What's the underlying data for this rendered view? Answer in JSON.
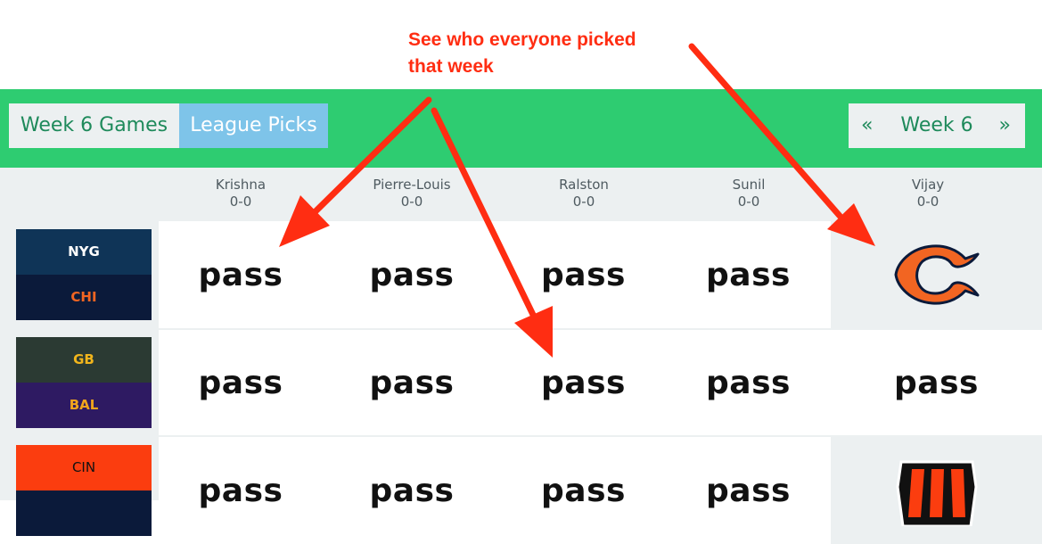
{
  "annotation": {
    "line1": "See who everyone picked",
    "line2": "that week"
  },
  "tabs": {
    "games": "Week 6 Games",
    "picks": "League Picks"
  },
  "week_nav": {
    "prev": "«",
    "label": "Week 6",
    "next": "»"
  },
  "players": [
    {
      "name": "Krishna",
      "record": "0-0"
    },
    {
      "name": "Pierre-Louis",
      "record": "0-0"
    },
    {
      "name": "Ralston",
      "record": "0-0"
    },
    {
      "name": "Sunil",
      "record": "0-0"
    },
    {
      "name": "Vijay",
      "record": "0-0"
    }
  ],
  "games": [
    {
      "away": {
        "abbr": "NYG",
        "bg": "#0f3457",
        "fg": "#ffffff"
      },
      "home": {
        "abbr": "CHI",
        "bg": "#0b1a3a",
        "fg": "#f26522"
      },
      "picks": [
        "pass",
        "pass",
        "pass",
        "pass",
        "bears-logo"
      ]
    },
    {
      "away": {
        "abbr": "GB",
        "bg": "#2b3a33",
        "fg": "#f2b51c"
      },
      "home": {
        "abbr": "BAL",
        "bg": "#2e1a62",
        "fg": "#f2a51c"
      },
      "picks": [
        "pass",
        "pass",
        "pass",
        "pass",
        "pass"
      ]
    },
    {
      "away": {
        "abbr": "CIN",
        "bg": "#fb3d0f",
        "fg": "#111111"
      },
      "home": {
        "abbr": "",
        "bg": "#0b1a3a",
        "fg": "#ffffff"
      },
      "picks": [
        "pass",
        "pass",
        "pass",
        "pass",
        "bengals-logo"
      ]
    }
  ],
  "colors": {
    "green": "#2ecc71",
    "arrow": "#ff2d12",
    "panel": "#ecf0f1"
  }
}
